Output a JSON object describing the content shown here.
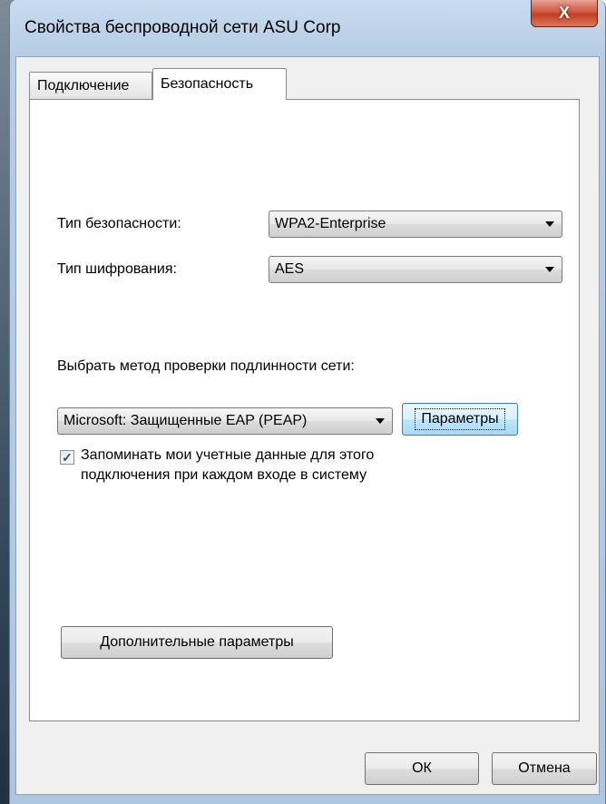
{
  "window": {
    "title": "Свойства беспроводной сети ASU Corp",
    "close_label": "X"
  },
  "tabs": [
    {
      "label": "Подключение",
      "active": false
    },
    {
      "label": "Безопасность",
      "active": true
    }
  ],
  "security": {
    "security_type_label": "Тип безопасности:",
    "security_type_value": "WPA2-Enterprise",
    "encryption_type_label": "Тип шифрования:",
    "encryption_type_value": "AES",
    "auth_method_label": "Выбрать метод проверки подлинности сети:",
    "auth_method_value": "Microsoft: Защищенные EAP (PEAP)",
    "params_button": "Параметры",
    "remember_checked": true,
    "remember_line1": "Запоминать мои учетные данные для этого",
    "remember_line2": "подключения при каждом входе в систему",
    "advanced_button": "Дополнительные параметры"
  },
  "footer": {
    "ok_button": "ОК",
    "cancel_button": "Отмена"
  },
  "colors": {
    "titlebar": "#c9dcef",
    "close_button": "#c43e22",
    "focus_button": "#bee6fd"
  }
}
